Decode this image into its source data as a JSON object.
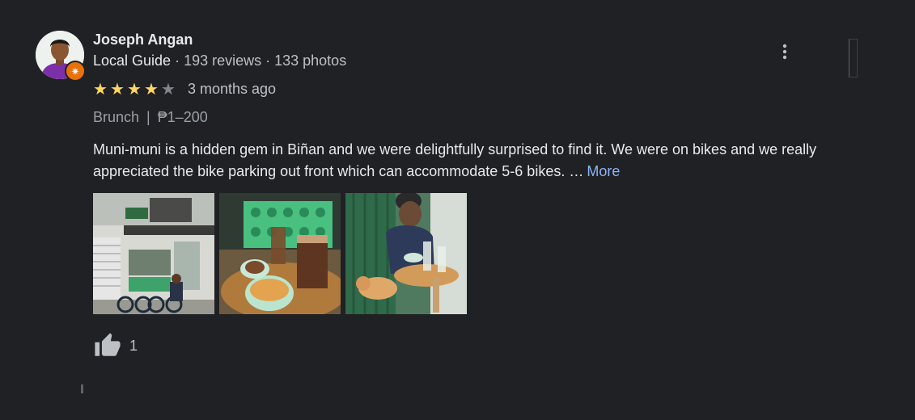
{
  "reviewer": {
    "name": "Joseph Angan",
    "level": "Local Guide",
    "stats": " · 193 reviews · 133 photos",
    "avatar_icon": "person-avatar",
    "badge_icon": "local-guide-star-icon"
  },
  "rating": {
    "value": 4,
    "max": 5,
    "date": "3 months ago",
    "star_color": "#fdd663"
  },
  "tags": {
    "meal": "Brunch",
    "separator": "|",
    "price": "₱1–200"
  },
  "review": {
    "text": "Muni-muni is a hidden gem in Biñan and we were delightfully surprised to find it. We were on bikes and we really appreciated the bike parking out front which can accommodate 5-6 bikes. …",
    "more_label": "More",
    "link_color": "#8ab4f8"
  },
  "photos": [
    {
      "subject": "cafe-storefront-with-bikes"
    },
    {
      "subject": "iced-coffee-and-croissant"
    },
    {
      "subject": "person-at-table-with-cat"
    }
  ],
  "likes": {
    "count": "1",
    "icon": "thumbs-up-icon"
  },
  "menu": {
    "icon": "more-vert-icon"
  }
}
